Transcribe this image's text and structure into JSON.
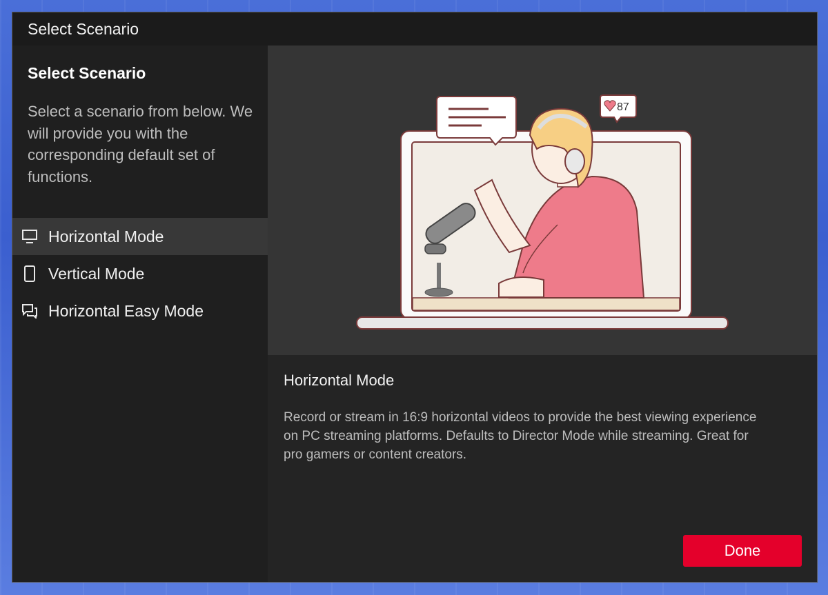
{
  "window": {
    "title": "Select Scenario"
  },
  "sidebar": {
    "heading": "Select Scenario",
    "description": "Select a scenario from below. We will provide you with the corresponding default set of functions.",
    "items": [
      {
        "label": "Horizontal Mode",
        "icon": "monitor-icon",
        "selected": true
      },
      {
        "label": "Vertical Mode",
        "icon": "phone-icon",
        "selected": false
      },
      {
        "label": "Horizontal Easy Mode",
        "icon": "chat-icon",
        "selected": false
      }
    ]
  },
  "main": {
    "illustration": {
      "likes": "87"
    },
    "title": "Horizontal Mode",
    "description": "Record or stream in 16:9 horizontal videos to provide the best viewing experience on PC streaming platforms. Defaults to Director Mode while streaming. Great for pro gamers or content creators.",
    "done_label": "Done"
  },
  "colors": {
    "accent": "#e4002b",
    "selected_bg": "#383838",
    "panel_bg": "#242424"
  }
}
